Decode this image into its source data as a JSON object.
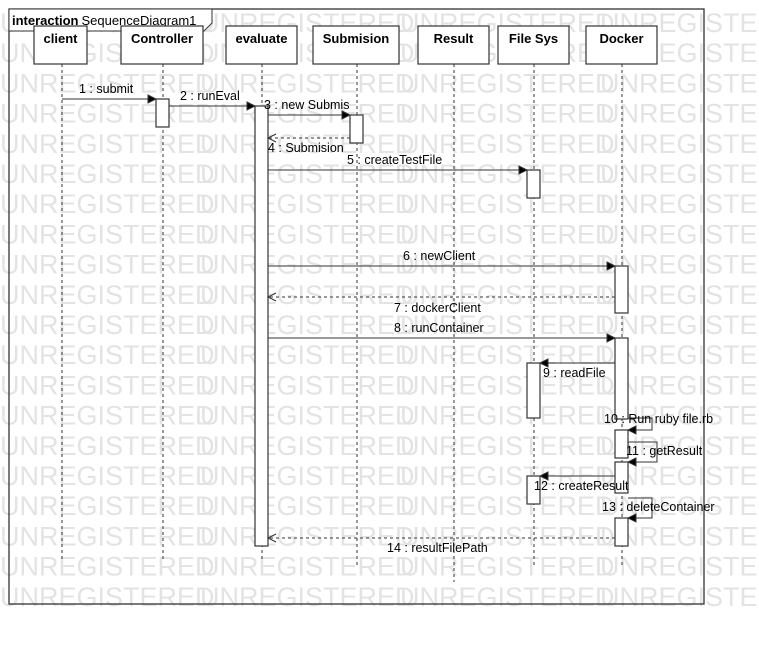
{
  "frame": {
    "keyword": "interaction",
    "name": "SequenceDiagram1"
  },
  "watermark": "UNREGISTERED",
  "lifelines": [
    {
      "id": "client",
      "name": "client"
    },
    {
      "id": "controller",
      "name": "Controller"
    },
    {
      "id": "evaluate",
      "name": "evaluate"
    },
    {
      "id": "submision",
      "name": "Submision"
    },
    {
      "id": "result",
      "name": "Result"
    },
    {
      "id": "filesys",
      "name": "File Sys"
    },
    {
      "id": "docker",
      "name": "Docker"
    }
  ],
  "messages": [
    {
      "label": "1 : submit",
      "from": "client",
      "to": "controller",
      "kind": "sync"
    },
    {
      "label": "2 : runEval",
      "from": "controller",
      "to": "evaluate",
      "kind": "sync"
    },
    {
      "label": "3 : new Submis",
      "from": "evaluate",
      "to": "submision",
      "kind": "sync"
    },
    {
      "label": "4 : Submision",
      "from": "submision",
      "to": "evaluate",
      "kind": "return"
    },
    {
      "label": "5 : createTestFile",
      "from": "evaluate",
      "to": "filesys",
      "kind": "sync"
    },
    {
      "label": "6 : newClient",
      "from": "evaluate",
      "to": "docker",
      "kind": "sync"
    },
    {
      "label": "7 : dockerClient",
      "from": "docker",
      "to": "evaluate",
      "kind": "return"
    },
    {
      "label": "8 : runContainer",
      "from": "evaluate",
      "to": "docker",
      "kind": "sync"
    },
    {
      "label": "9 : readFile",
      "from": "docker",
      "to": "filesys",
      "kind": "sync"
    },
    {
      "label": "10 : Run ruby file.rb",
      "from": "docker",
      "to": "docker",
      "kind": "self"
    },
    {
      "label": "11 : getResult",
      "from": "docker",
      "to": "docker",
      "kind": "self"
    },
    {
      "label": "12 : createResult",
      "from": "docker",
      "to": "filesys",
      "kind": "sync"
    },
    {
      "label": "13 : deleteContainer",
      "from": "docker",
      "to": "docker",
      "kind": "self"
    },
    {
      "label": "14 : resultFilePath",
      "from": "docker",
      "to": "evaluate",
      "kind": "return"
    }
  ],
  "colors": {
    "line": "#333333",
    "box_fill": "#ffffff",
    "watermark": "#e3e3e3"
  }
}
